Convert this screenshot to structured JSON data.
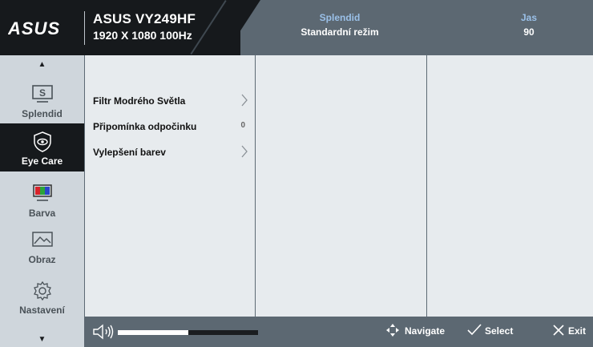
{
  "header": {
    "brand": "ASUS",
    "model": "ASUS VY249HF",
    "resolution": "1920 X 1080 100Hz",
    "mode_label": "Splendid",
    "mode_value": "Standardní režim",
    "brightness_label": "Jas",
    "brightness_value": "90"
  },
  "sidebar": {
    "items": [
      {
        "label": "Splendid",
        "icon": "splendid-icon",
        "active": false
      },
      {
        "label": "Eye Care",
        "icon": "eye-care-icon",
        "active": true
      },
      {
        "label": "Barva",
        "icon": "color-icon",
        "active": false
      },
      {
        "label": "Obraz",
        "icon": "image-icon",
        "active": false
      },
      {
        "label": "Nastavení",
        "icon": "settings-icon",
        "active": false
      }
    ]
  },
  "menu": {
    "items": [
      {
        "label": "Filtr Modrého Světla",
        "value": "",
        "has_submenu": true
      },
      {
        "label": "Připomínka odpočinku",
        "value": "0",
        "has_submenu": false
      },
      {
        "label": "Vylepšení barev",
        "value": "",
        "has_submenu": true
      }
    ]
  },
  "bottom": {
    "volume_level": 0.5,
    "navigate_label": "Navigate",
    "select_label": "Select",
    "exit_label": "Exit"
  },
  "colors": {
    "header_dark": "#16191c",
    "header_gray": "#5c6872",
    "accent_blue": "#9ac0e8",
    "sidebar_bg": "#cfd6dc",
    "panel_bg": "#e7ebee"
  }
}
